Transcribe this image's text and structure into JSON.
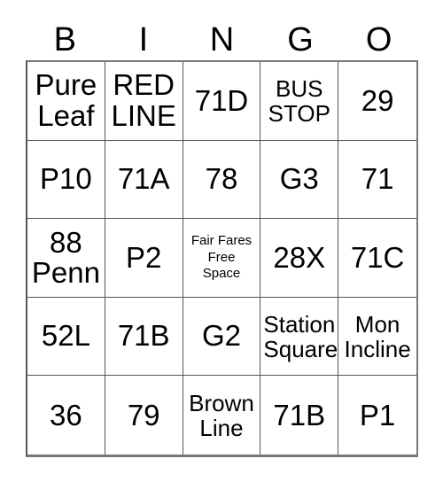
{
  "card": {
    "title": "BINGO",
    "headers": [
      "B",
      "I",
      "N",
      "G",
      "O"
    ],
    "colors": {
      "background": "#ffffff",
      "text": "#000000",
      "grid_line": "#555555",
      "grid_border": "#777777"
    },
    "rows": [
      [
        {
          "text": "Pure\nLeaf",
          "size": "lg"
        },
        {
          "text": "RED\nLINE",
          "size": "lg"
        },
        {
          "text": "71D",
          "size": "lg"
        },
        {
          "text": "BUS\nSTOP",
          "size": "md"
        },
        {
          "text": "29",
          "size": "lg"
        }
      ],
      [
        {
          "text": "P10",
          "size": "lg"
        },
        {
          "text": "71A",
          "size": "lg"
        },
        {
          "text": "78",
          "size": "lg"
        },
        {
          "text": "G3",
          "size": "lg"
        },
        {
          "text": "71",
          "size": "lg"
        }
      ],
      [
        {
          "text": "88\nPenn",
          "size": "lg"
        },
        {
          "text": "P2",
          "size": "lg"
        },
        {
          "text": "Fair Fares\nFree\nSpace",
          "size": "sm"
        },
        {
          "text": "28X",
          "size": "lg"
        },
        {
          "text": "71C",
          "size": "lg"
        }
      ],
      [
        {
          "text": "52L",
          "size": "lg"
        },
        {
          "text": "71B",
          "size": "lg"
        },
        {
          "text": "G2",
          "size": "lg"
        },
        {
          "text": "Station\nSquare",
          "size": "md"
        },
        {
          "text": "Mon\nIncline",
          "size": "md"
        }
      ],
      [
        {
          "text": "36",
          "size": "lg"
        },
        {
          "text": "79",
          "size": "lg"
        },
        {
          "text": "Brown\nLine",
          "size": "md"
        },
        {
          "text": "71B",
          "size": "lg"
        },
        {
          "text": "P1",
          "size": "lg"
        }
      ]
    ]
  }
}
